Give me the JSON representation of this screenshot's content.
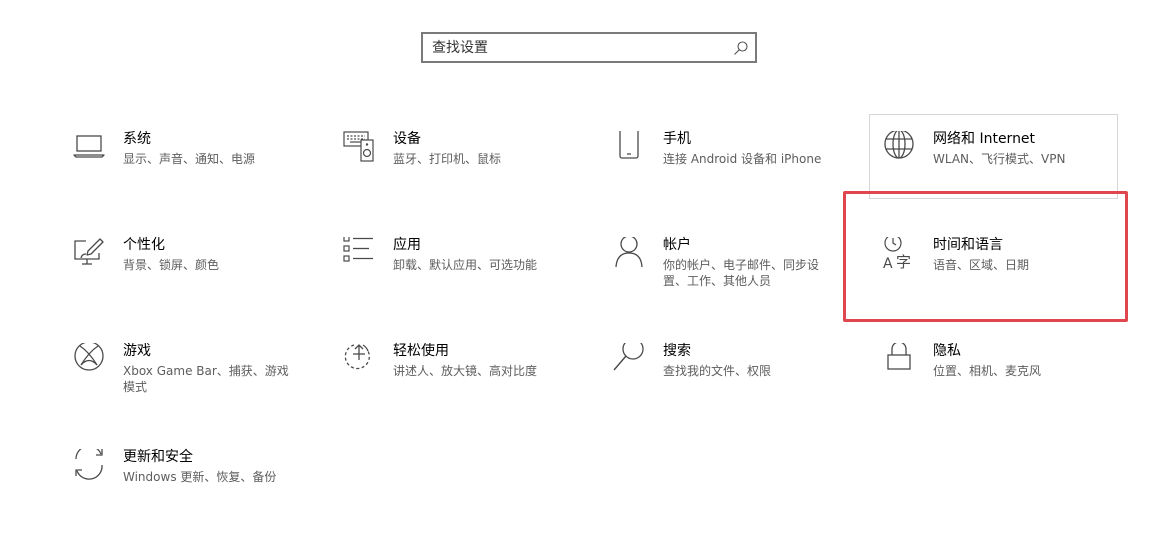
{
  "search": {
    "placeholder": "查找设置",
    "icon": "search-icon"
  },
  "tiles": [
    {
      "key": "system",
      "title": "系统",
      "desc": "显示、声音、通知、电源",
      "icon": "laptop-icon"
    },
    {
      "key": "devices",
      "title": "设备",
      "desc": "蓝牙、打印机、鼠标",
      "icon": "keyboard-speaker-icon"
    },
    {
      "key": "phone",
      "title": "手机",
      "desc": "连接 Android 设备和 iPhone",
      "icon": "phone-icon"
    },
    {
      "key": "network",
      "title": "网络和 Internet",
      "desc": "WLAN、飞行模式、VPN",
      "icon": "globe-icon"
    },
    {
      "key": "personalization",
      "title": "个性化",
      "desc": "背景、锁屏、颜色",
      "icon": "paint-display-icon"
    },
    {
      "key": "apps",
      "title": "应用",
      "desc": "卸载、默认应用、可选功能",
      "icon": "app-list-icon"
    },
    {
      "key": "accounts",
      "title": "帐户",
      "desc": "你的帐户、电子邮件、同步设置、工作、其他人员",
      "icon": "person-icon"
    },
    {
      "key": "time-language",
      "title": "时间和语言",
      "desc": "语音、区域、日期",
      "icon": "time-language-icon"
    },
    {
      "key": "gaming",
      "title": "游戏",
      "desc": "Xbox Game Bar、捕获、游戏模式",
      "icon": "xbox-icon"
    },
    {
      "key": "ease-of-access",
      "title": "轻松使用",
      "desc": "讲述人、放大镜、高对比度",
      "icon": "ease-of-access-icon"
    },
    {
      "key": "search",
      "title": "搜索",
      "desc": "查找我的文件、权限",
      "icon": "magnifier-icon"
    },
    {
      "key": "privacy",
      "title": "隐私",
      "desc": "位置、相机、麦克风",
      "icon": "lock-icon"
    },
    {
      "key": "update-security",
      "title": "更新和安全",
      "desc": "Windows 更新、恢复、备份",
      "icon": "sync-arrows-icon"
    }
  ],
  "colors": {
    "highlight": "#e0464d",
    "icon_stroke": "#4a4a4a",
    "description_text": "#5d5d5d"
  }
}
